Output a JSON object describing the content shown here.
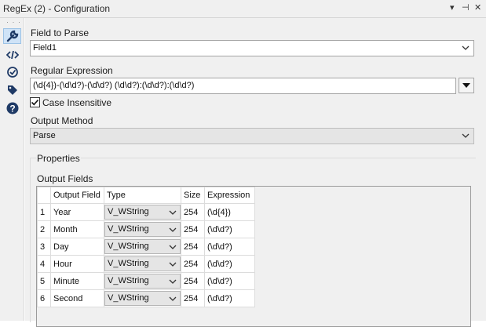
{
  "window": {
    "title": "RegEx (2) - Configuration",
    "controls": [
      "▾",
      "⊣",
      "✕"
    ]
  },
  "sidebar": {
    "icons": [
      "wrench-icon",
      "code-icon",
      "target-icon",
      "tag-icon",
      "help-icon"
    ]
  },
  "form": {
    "field_to_parse_label": "Field to Parse",
    "field_to_parse_value": "Field1",
    "regex_label": "Regular Expression",
    "regex_value": "(\\d{4})-(\\d\\d?)-(\\d\\d?) (\\d\\d?):(\\d\\d?):(\\d\\d?)",
    "case_insensitive_label": "Case Insensitive",
    "case_insensitive_checked": true,
    "output_method_label": "Output Method",
    "output_method_value": "Parse"
  },
  "properties": {
    "title": "Properties",
    "output_fields_label": "Output Fields",
    "columns": [
      "Output Field",
      "Type",
      "Size",
      "Expression"
    ],
    "rows": [
      {
        "num": "1",
        "field": "Year",
        "type": "V_WString",
        "size": "254",
        "expr": "(\\d{4})"
      },
      {
        "num": "2",
        "field": "Month",
        "type": "V_WString",
        "size": "254",
        "expr": "(\\d\\d?)"
      },
      {
        "num": "3",
        "field": "Day",
        "type": "V_WString",
        "size": "254",
        "expr": "(\\d\\d?)"
      },
      {
        "num": "4",
        "field": "Hour",
        "type": "V_WString",
        "size": "254",
        "expr": "(\\d\\d?)"
      },
      {
        "num": "5",
        "field": "Minute",
        "type": "V_WString",
        "size": "254",
        "expr": "(\\d\\d?)"
      },
      {
        "num": "6",
        "field": "Second",
        "type": "V_WString",
        "size": "254",
        "expr": "(\\d\\d?)"
      }
    ]
  }
}
